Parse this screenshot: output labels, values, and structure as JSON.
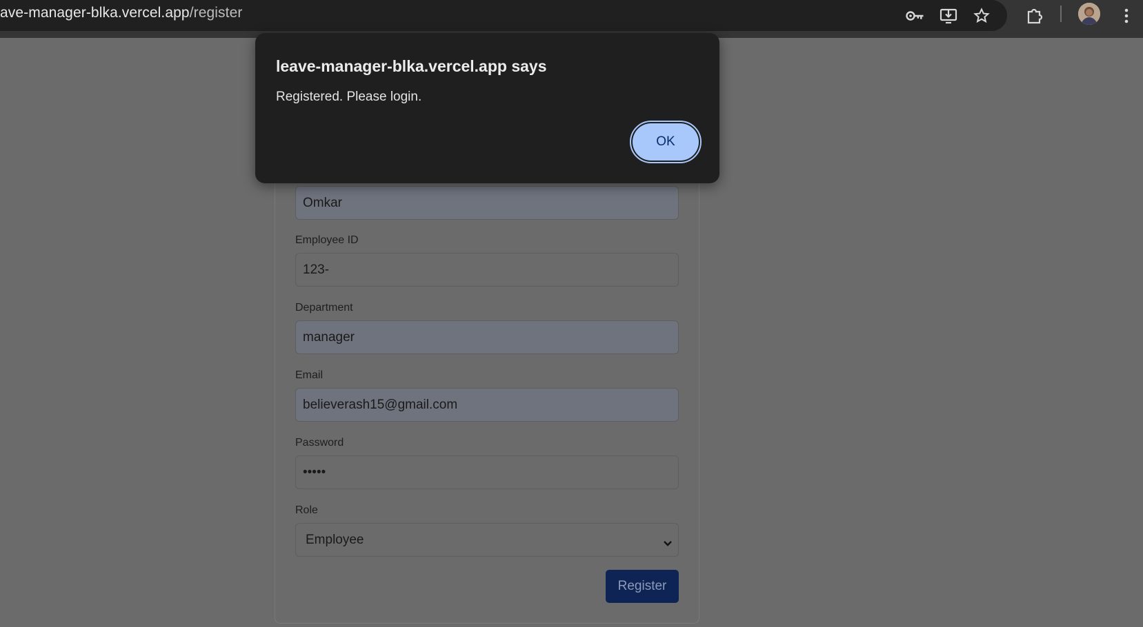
{
  "browser": {
    "url_host": "ave-manager-blka.vercel.app",
    "url_path": "/register",
    "icons": [
      "password-key-icon",
      "install-app-icon",
      "bookmark-star-icon",
      "extensions-icon",
      "profile-avatar",
      "more-menu-icon"
    ]
  },
  "form": {
    "name_value": "Omkar",
    "employee_id_label": "Employee ID",
    "employee_id_value": "123-",
    "department_label": "Department",
    "department_value": "manager",
    "email_label": "Email",
    "email_value": "believerash15@gmail.com",
    "password_label": "Password",
    "password_value": "•••••",
    "role_label": "Role",
    "role_value": "Employee",
    "register_label": "Register"
  },
  "dialog": {
    "title": "leave-manager-blka.vercel.app says",
    "message": "Registered. Please login.",
    "ok_label": "OK"
  },
  "colors": {
    "accent": "#a8c7fa",
    "button": "#0d2455",
    "dialog_bg": "#1f1f1f"
  }
}
